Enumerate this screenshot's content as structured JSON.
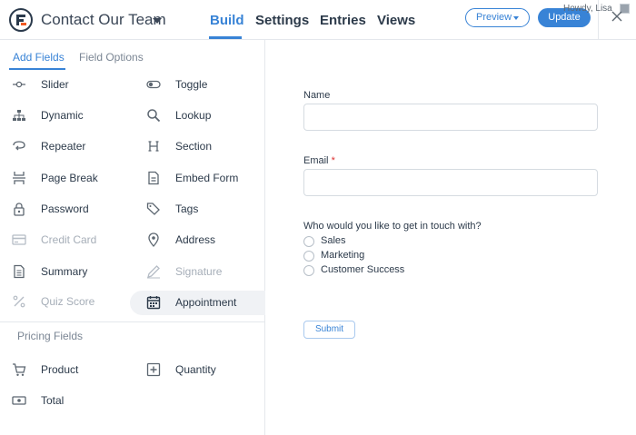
{
  "header": {
    "form_title": "Contact Our Team",
    "tabs": [
      {
        "label": "Build",
        "active": true
      },
      {
        "label": "Settings",
        "active": false
      },
      {
        "label": "Entries",
        "active": false
      },
      {
        "label": "Views",
        "active": false
      }
    ],
    "preview_label": "Preview",
    "update_label": "Update",
    "howdy_text": "Howdy, Lisa",
    "accent_color": "#3883d6"
  },
  "sidebar": {
    "tabs": [
      {
        "label": "Add Fields",
        "active": true
      },
      {
        "label": "Field Options",
        "active": false
      }
    ],
    "fields": [
      {
        "label": "Slider",
        "icon": "slider-icon",
        "enabled": true
      },
      {
        "label": "Toggle",
        "icon": "toggle-icon",
        "enabled": true
      },
      {
        "label": "Dynamic",
        "icon": "sitemap-icon",
        "enabled": true
      },
      {
        "label": "Lookup",
        "icon": "magnifier-icon",
        "enabled": true
      },
      {
        "label": "Repeater",
        "icon": "repeat-icon",
        "enabled": true
      },
      {
        "label": "Section",
        "icon": "heading-icon",
        "enabled": true
      },
      {
        "label": "Page Break",
        "icon": "page-break-icon",
        "enabled": true
      },
      {
        "label": "Embed Form",
        "icon": "document-icon",
        "enabled": true
      },
      {
        "label": "Password",
        "icon": "lock-icon",
        "enabled": true
      },
      {
        "label": "Tags",
        "icon": "tags-icon",
        "enabled": true
      },
      {
        "label": "Credit Card",
        "icon": "credit-card-icon",
        "enabled": false
      },
      {
        "label": "Address",
        "icon": "map-pin-icon",
        "enabled": true
      },
      {
        "label": "Summary",
        "icon": "summary-icon",
        "enabled": true
      },
      {
        "label": "Signature",
        "icon": "pen-icon",
        "enabled": false
      },
      {
        "label": "Quiz Score",
        "icon": "percent-icon",
        "enabled": false
      },
      {
        "label": "Appointment",
        "icon": "calendar-icon",
        "enabled": true,
        "highlighted": true
      }
    ],
    "pricing_label": "Pricing Fields",
    "pricing_fields": [
      {
        "label": "Product",
        "icon": "cart-icon"
      },
      {
        "label": "Quantity",
        "icon": "plus-box-icon"
      },
      {
        "label": "Total",
        "icon": "money-icon"
      }
    ]
  },
  "form": {
    "name_label": "Name",
    "email_label": "Email",
    "required_mark": "*",
    "question_label": "Who would you like to get in touch with?",
    "options": [
      "Sales",
      "Marketing",
      "Customer Success"
    ],
    "submit_label": "Submit"
  }
}
